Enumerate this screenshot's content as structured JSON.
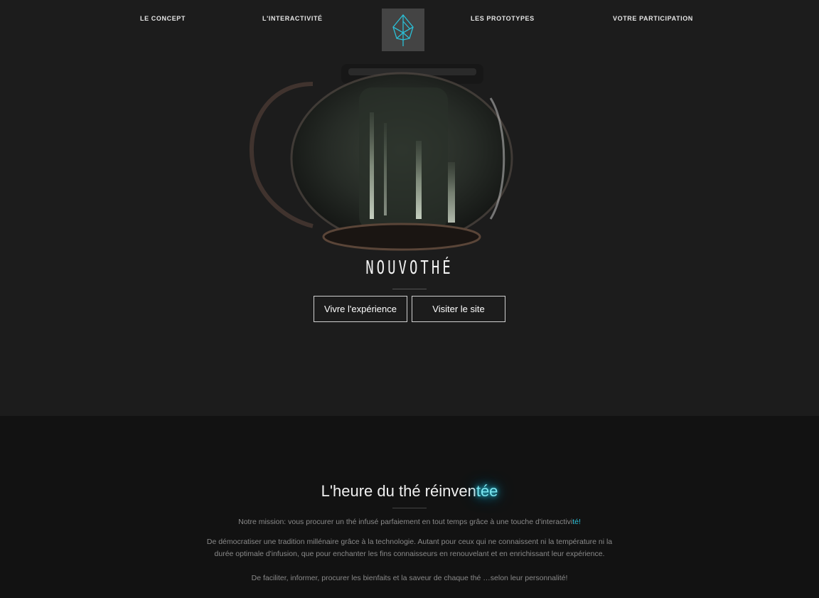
{
  "nav": {
    "items": [
      {
        "label": "LE CONCEPT"
      },
      {
        "label": "L'INTERACTIVITÉ"
      },
      {
        "label": "LES PROTOTYPES"
      },
      {
        "label": "VOTRE PARTICIPATION"
      }
    ],
    "logo_icon": "leaf-logo-icon"
  },
  "hero": {
    "brand": "NOUVOTHÉ",
    "image": "teapot-image",
    "buttons": {
      "experience": "Vivre l'expérience",
      "visit": "Visiter le site"
    }
  },
  "mission": {
    "heading_main": "L'heure du thé réinven",
    "heading_glow": "tée",
    "p1_main": "Notre mission: vous procurer un thé infusé parfaiement en tout temps grâce à une touche d'interactivi",
    "p1_accent": "té!",
    "p2": "De démocratiser une tradition millénaire grâce à la technologie. Autant pour ceux qui ne connaissent ni la température ni la durée optimale d'infusion, que pour enchanter les fins connaisseurs en renouvelant et en enrichissant leur expérience.",
    "p3": "De faciliter, informer, procurer les bienfaits et la saveur de chaque thé …selon leur personnalité!"
  },
  "colors": {
    "hero_bg": "#1c1c1c",
    "section_bg": "#121212",
    "accent": "#2fc4dc",
    "logo_bg": "#444444"
  }
}
